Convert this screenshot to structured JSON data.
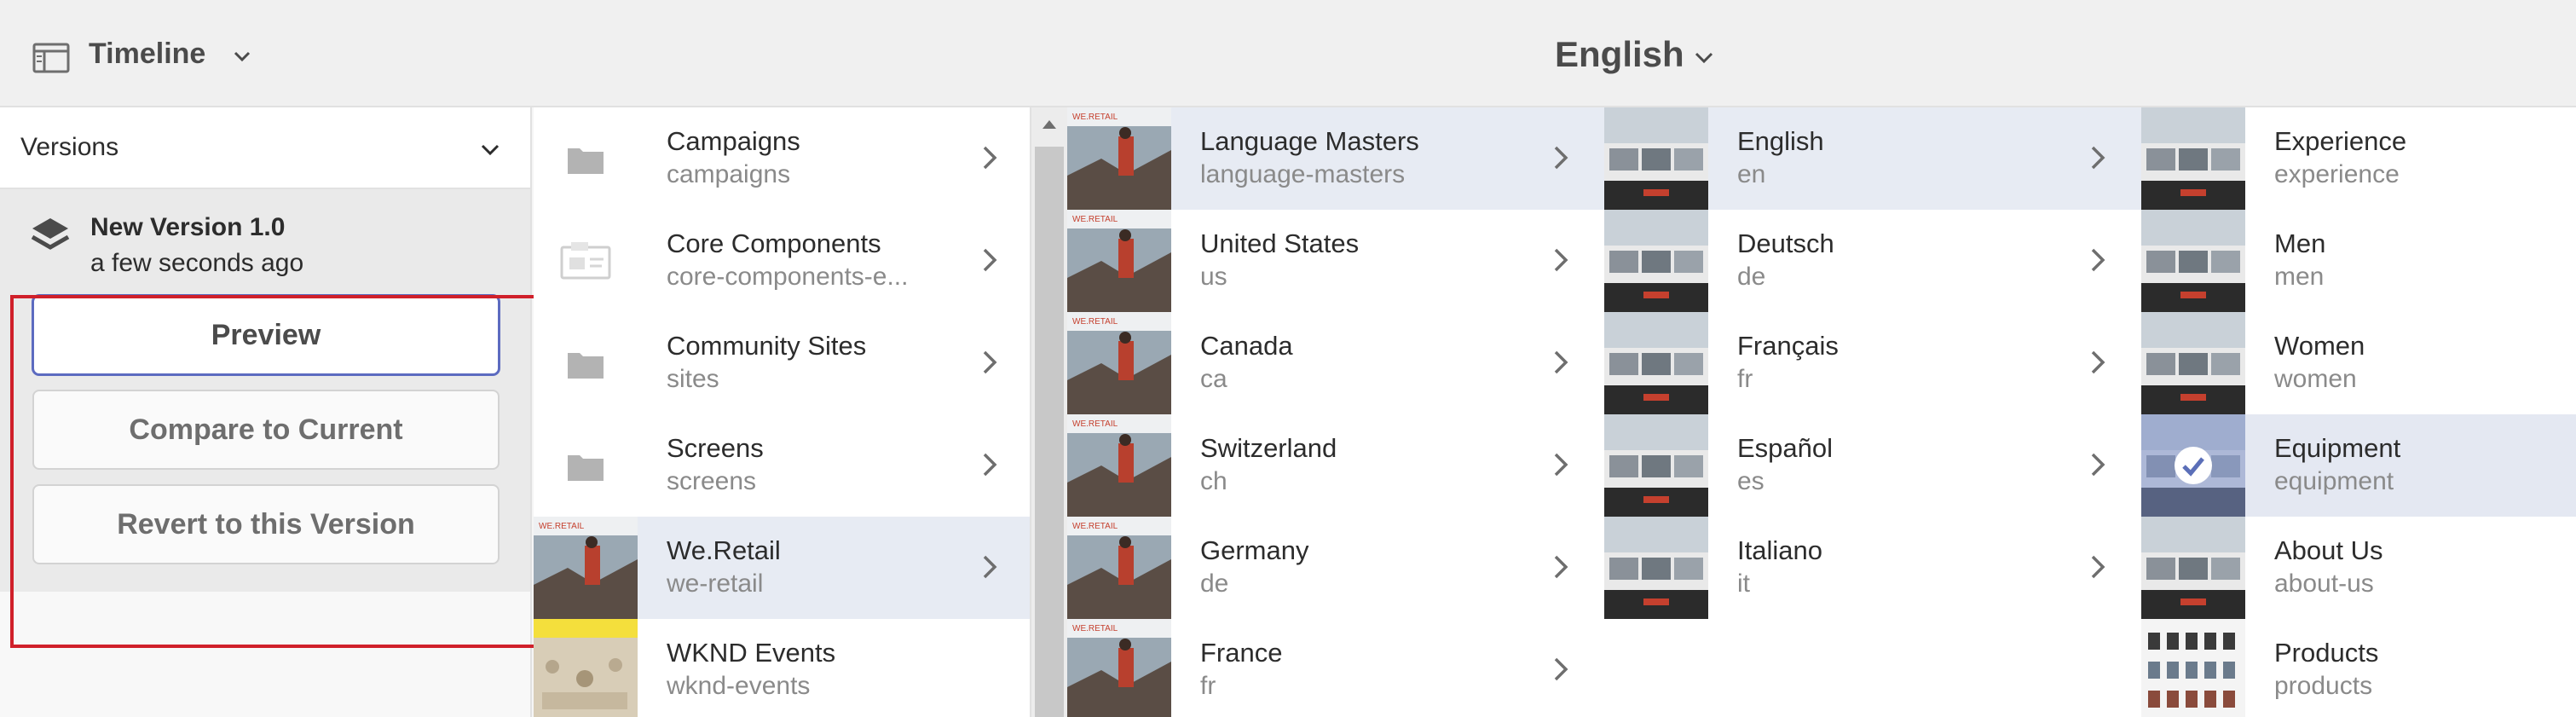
{
  "header": {
    "panel_label": "Timeline",
    "language": "English"
  },
  "rail": {
    "versions_label": "Versions",
    "version": {
      "title": "New Version 1.0",
      "time": "a few seconds ago"
    },
    "buttons": {
      "preview": "Preview",
      "compare": "Compare to Current",
      "revert": "Revert to this Version"
    }
  },
  "columns": {
    "sites": [
      {
        "title": "Campaigns",
        "sub": "campaigns"
      },
      {
        "title": "Core Components",
        "sub": "core-components-e..."
      },
      {
        "title": "Community Sites",
        "sub": "sites"
      },
      {
        "title": "Screens",
        "sub": "screens"
      },
      {
        "title": "We.Retail",
        "sub": "we-retail"
      },
      {
        "title": "WKND Events",
        "sub": "wknd-events"
      }
    ],
    "countries": [
      {
        "title": "Language Masters",
        "sub": "language-masters"
      },
      {
        "title": "United States",
        "sub": "us"
      },
      {
        "title": "Canada",
        "sub": "ca"
      },
      {
        "title": "Switzerland",
        "sub": "ch"
      },
      {
        "title": "Germany",
        "sub": "de"
      },
      {
        "title": "France",
        "sub": "fr"
      }
    ],
    "languages": [
      {
        "title": "English",
        "sub": "en"
      },
      {
        "title": "Deutsch",
        "sub": "de"
      },
      {
        "title": "Français",
        "sub": "fr"
      },
      {
        "title": "Español",
        "sub": "es"
      },
      {
        "title": "Italiano",
        "sub": "it"
      }
    ],
    "pages": [
      {
        "title": "Experience",
        "sub": "experience"
      },
      {
        "title": "Men",
        "sub": "men"
      },
      {
        "title": "Women",
        "sub": "women"
      },
      {
        "title": "Equipment",
        "sub": "equipment"
      },
      {
        "title": "About Us",
        "sub": "about-us"
      },
      {
        "title": "Products",
        "sub": "products"
      }
    ]
  },
  "thumb_brand": "WE.RETAIL",
  "colors": {
    "selected_row": "#e7ebf3",
    "highlight_box": "#d0202a",
    "primary_button_border": "#5c6bc0"
  }
}
